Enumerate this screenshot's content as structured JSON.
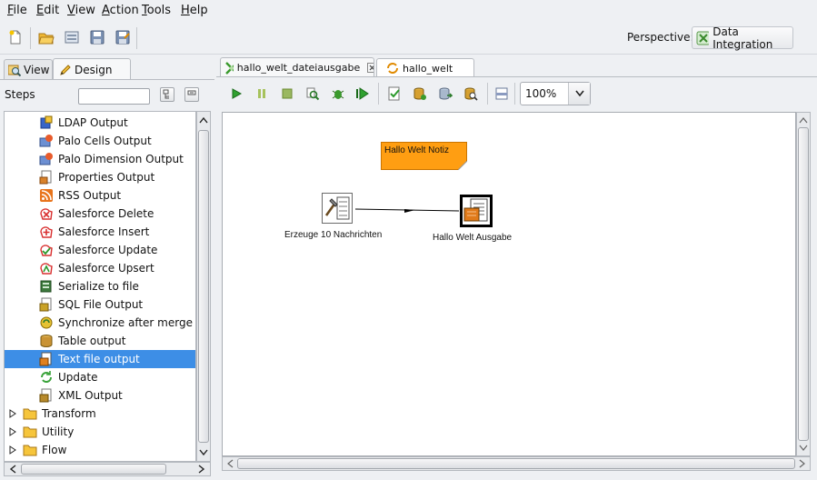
{
  "menubar": {
    "items": [
      {
        "accel": "F",
        "rest": "ile"
      },
      {
        "accel": "E",
        "rest": "dit"
      },
      {
        "accel": "V",
        "rest": "iew"
      },
      {
        "accel": "A",
        "rest": "ction"
      },
      {
        "accel": "T",
        "rest": "ools"
      },
      {
        "accel": "H",
        "rest": "elp"
      }
    ]
  },
  "toolbar": {
    "perspective_label": "Perspective:",
    "perspective_value": "Data Integration"
  },
  "left_panel": {
    "tab_view": "View",
    "tab_design": "Design",
    "steps_label": "Steps",
    "search_value": "",
    "tree": [
      {
        "label": "LDAP Output",
        "icon": "ldap-output-icon",
        "color": "#2e5fb8"
      },
      {
        "label": "Palo Cells Output",
        "icon": "palo-cells-output-icon",
        "color": "#5a7fc4"
      },
      {
        "label": "Palo Dimension Output",
        "icon": "palo-dimension-output-icon",
        "color": "#5a7fc4"
      },
      {
        "label": "Properties Output",
        "icon": "properties-output-icon",
        "color": "#d9822b"
      },
      {
        "label": "RSS Output",
        "icon": "rss-output-icon",
        "color": "#e8741c"
      },
      {
        "label": "Salesforce Delete",
        "icon": "salesforce-delete-icon",
        "color": "#d93030"
      },
      {
        "label": "Salesforce Insert",
        "icon": "salesforce-insert-icon",
        "color": "#d93030"
      },
      {
        "label": "Salesforce Update",
        "icon": "salesforce-update-icon",
        "color": "#d93030"
      },
      {
        "label": "Salesforce Upsert",
        "icon": "salesforce-upsert-icon",
        "color": "#d93030"
      },
      {
        "label": "Serialize to file",
        "icon": "serialize-to-file-icon",
        "color": "#3d7a3d"
      },
      {
        "label": "SQL File Output",
        "icon": "sql-file-output-icon",
        "color": "#c9a227"
      },
      {
        "label": "Synchronize after merge",
        "icon": "synchronize-after-merge-icon",
        "color": "#c9a227"
      },
      {
        "label": "Table output",
        "icon": "table-output-icon",
        "color": "#b78a2c"
      },
      {
        "label": "Text file output",
        "icon": "text-file-output-icon",
        "color": "#e0801f",
        "selected": true
      },
      {
        "label": "Update",
        "icon": "update-icon",
        "color": "#3aa33a"
      },
      {
        "label": "XML Output",
        "icon": "xml-output-icon",
        "color": "#b78a2c"
      }
    ],
    "folders": [
      {
        "label": "Transform"
      },
      {
        "label": "Utility"
      },
      {
        "label": "Flow"
      }
    ]
  },
  "editor": {
    "tabs": [
      {
        "label": "hallo_welt_dateiausgabe",
        "active": true
      },
      {
        "label": "hallo_welt",
        "active": false
      }
    ],
    "zoom": "100%",
    "note_text": "Hallo Welt Notiz",
    "steps": [
      {
        "label": "Erzeuge 10 Nachrichten"
      },
      {
        "label": "Hallo Welt Ausgabe"
      }
    ]
  }
}
